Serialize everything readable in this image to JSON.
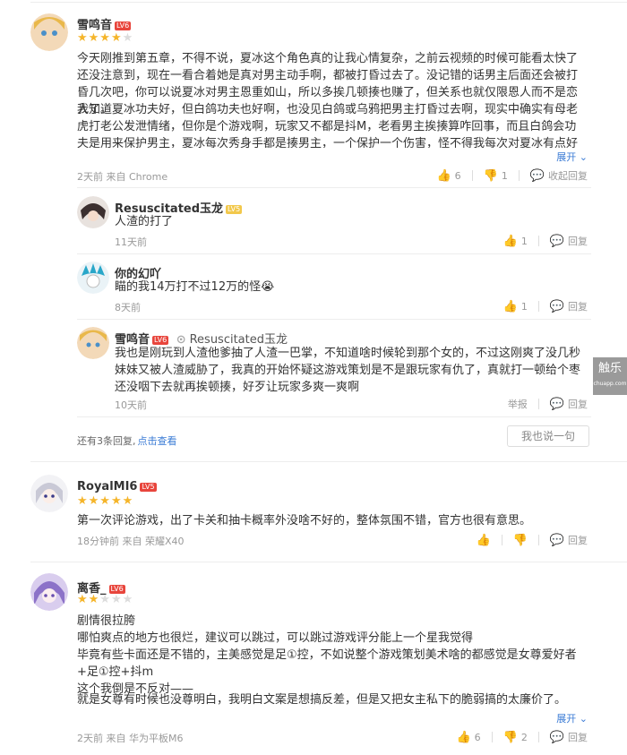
{
  "comments": [
    {
      "user": "雪鸣音",
      "level": "LV6",
      "stars": 4,
      "paragraphs": [
        "今天刚推到第五章，不得不说，夏冰这个角色真的让我心情复杂，之前云视频的时候可能看太快了还没注意到，现在一看合着她是真对男主动手啊，都被打昏过去了。没记错的话男主后面还会被打昏几次吧，你可以说夏冰对男主恩重如山，所以多挨几顿揍也赚了，但关系也就仅限恩人而不是恋人了。",
        "我知道夏冰功夫好，但白鸽功夫也好啊，也没见白鸽或乌鸦把男主打昏过去啊，现实中确实有母老虎打老公发泄情绪，但你是个游戏啊，玩家又不都是抖M，老看男主挨揍算咋回事，而且白鸽会功夫是用来保护男主，夏冰每次秀身手都是揍男主，一个保护一个伤害，怪不得我每次对夏冰有点好感时都感觉怪怪的，不仅是性转霸"
      ],
      "expand": "展开",
      "meta": "2天前 来自 Chrome",
      "likes": "6",
      "dislikes": "1",
      "fold": "收起回复",
      "replies": [
        {
          "user": "Resuscitated玉龙",
          "level": "LV5",
          "text": "人渣的打了",
          "meta": "11天前",
          "likes": "1",
          "reply": "回复"
        },
        {
          "user": "你的幻吖",
          "level": "",
          "text": "瞄的我14万打不过12万的怪",
          "emoji": "😭",
          "meta": "8天前",
          "likes": "1",
          "reply": "回复"
        },
        {
          "user": "雪鸣音",
          "level": "LV6",
          "reply_to": "Resuscitated玉龙",
          "text": "我也是刚玩到人渣他爹抽了人渣一巴掌，不知道啥时候轮到那个女的，不过这刚爽了没几秒妹妹又被人渣威胁了，我真的开始怀疑这游戏策划是不是跟玩家有仇了，真就打一顿给个枣还没咽下去就再挨顿揍，好歹让玩家多爽一爽啊",
          "meta": "10天前",
          "tag": "举报",
          "reply": "回复"
        }
      ],
      "more_replies": "还有3条回复,",
      "more_link": "点击查看",
      "reply_button": "我也说一句"
    },
    {
      "user": "RoyalMI6",
      "level": "LV5",
      "stars": 5,
      "text": "第一次评论游戏，出了卡关和抽卡概率外没啥不好的，整体氛围不错，官方也很有意思。",
      "meta": "18分钟前 来自 荣耀X40",
      "reply": "回复"
    },
    {
      "user": "离香_",
      "level": "LV6",
      "stars": 2,
      "lines": [
        "剧情很拉胯",
        "哪怕爽点的地方也很烂，建议可以跳过，可以跳过游戏评分能上一个星我觉得",
        "毕竟有些卡面还是不错的，主美感觉是足①控，不如说整个游戏策划美术啥的都感觉是女尊爱好者+足①控+抖m",
        "这个我倒是不反对——",
        "就是女尊有时候也没尊明白，我明白文案是想搞反差，但是又把女主私下的脆弱搞的太廉价了。"
      ],
      "expand": "展开",
      "meta": "2天前 来自 华为平板M6",
      "likes": "6",
      "dislikes": "2",
      "reply": "回复"
    }
  ],
  "side_tag": {
    "title": "触乐",
    "sub": "chuapp.com"
  },
  "colors": {
    "accent": "#3a7bd5",
    "star": "#f5b52a",
    "level_red": "#e8453c"
  }
}
